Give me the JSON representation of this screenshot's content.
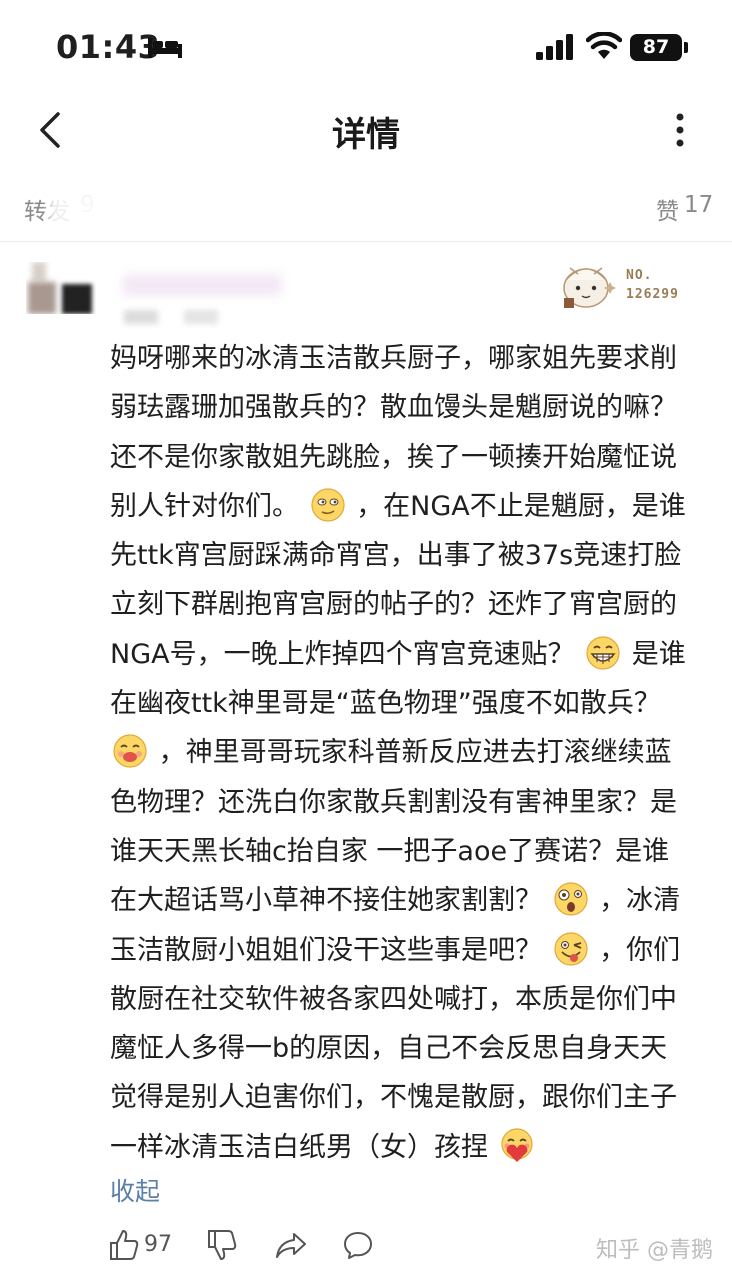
{
  "status_bar": {
    "time": "01:43",
    "battery": "87"
  },
  "nav": {
    "title": "详情"
  },
  "stats": {
    "repost_label": "转发",
    "repost_count": "9",
    "like_label": "赞",
    "like_count": "17"
  },
  "badge": {
    "label": "NO.",
    "number": "126299"
  },
  "comment": {
    "lines": [
      "妈呀哪来的冰清玉洁散兵厨子，哪家姐先要求削",
      "弱珐露珊加强散兵的？散血馒头是魈厨说的嘛？",
      "还不是你家散姐先跳脸，挨了一顿揍开始魔怔说",
      "别人针对你们。",
      "，在NGA不止是魈厨，是谁",
      "先ttk宵宫厨踩满命宵宫，出事了被37s竞速打脸",
      "立刻下群剧抱宵宫厨的帖子的？还炸了宵宫厨的",
      "NGA号，一晚上炸掉四个宵宫竞速贴？",
      "是谁",
      "在幽夜ttk神里哥是“蓝色物理”强度不如散兵？",
      "，神里哥哥玩家科普新反应进去打滚继续蓝",
      "色物理？还洗白你家散兵割割没有害神里家？是",
      "谁天天黑长轴c抬自家 一把子aoe了赛诺？是谁",
      "在大超话骂小草神不接住她家割割？",
      "，冰清",
      "玉洁散厨小姐姐们没干这些事是吧？",
      "，你们",
      "散厨在社交软件被各家四处喊打，本质是你们中",
      "魔怔人多得一b的原因，自己不会反思自身天天",
      "觉得是别人迫害你们，不愧是散厨，跟你们主子",
      "一样冰清玉洁白纸男（女）孩捏"
    ],
    "emojis": [
      "smirk-emoji",
      "grin-emoji",
      "yum-emoji",
      "shocked-emoji",
      "wink-tongue-emoji",
      "hug-emoji"
    ],
    "collapse": "收起"
  },
  "actions": {
    "like_count": "97",
    "watermark": "知乎 @青鹅"
  }
}
